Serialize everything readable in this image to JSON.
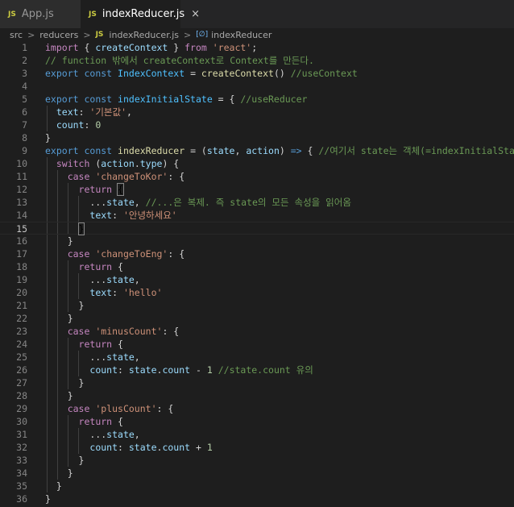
{
  "tabs": [
    {
      "icon": "JS",
      "label": "App.js",
      "active": false
    },
    {
      "icon": "JS",
      "label": "indexReducer.js",
      "active": true,
      "close": "×"
    }
  ],
  "breadcrumb": {
    "folders": [
      "src",
      "reducers"
    ],
    "file_icon": "JS",
    "file": "indexReducer.js",
    "symbol_icon": "[∅]",
    "symbol": "indexReducer",
    "separator": ">"
  },
  "editor": {
    "current_line": 15,
    "colors": {
      "background": "#1e1e1e",
      "keyword": "#569cd6",
      "control": "#c586c0",
      "function": "#dcdcaa",
      "variable": "#9cdcfe",
      "string": "#ce9178",
      "number": "#b5cea8",
      "comment": "#6a9955"
    },
    "lines": [
      [
        [
          "c",
          "import"
        ],
        [
          "p",
          " { "
        ],
        [
          "v",
          "createContext"
        ],
        [
          "p",
          " } "
        ],
        [
          "c",
          "from"
        ],
        [
          "p",
          " "
        ],
        [
          "s",
          "'react'"
        ],
        [
          "p",
          ";"
        ]
      ],
      [
        [
          "cm",
          "// function 밖에서 createContext로 Context를 만든다."
        ]
      ],
      [
        [
          "k",
          "export"
        ],
        [
          "p",
          " "
        ],
        [
          "k",
          "const"
        ],
        [
          "p",
          " "
        ],
        [
          "cv",
          "IndexContext"
        ],
        [
          "p",
          " = "
        ],
        [
          "f",
          "createContext"
        ],
        [
          "p",
          "() "
        ],
        [
          "cm",
          "//useContext"
        ]
      ],
      [],
      [
        [
          "k",
          "export"
        ],
        [
          "p",
          " "
        ],
        [
          "k",
          "const"
        ],
        [
          "p",
          " "
        ],
        [
          "cv",
          "indexInitialState"
        ],
        [
          "p",
          " = { "
        ],
        [
          "cm",
          "//useReducer"
        ]
      ],
      [
        [
          "p",
          "  "
        ],
        [
          "v",
          "text"
        ],
        [
          "p",
          ": "
        ],
        [
          "s",
          "'기본값'"
        ],
        [
          "p",
          ","
        ]
      ],
      [
        [
          "p",
          "  "
        ],
        [
          "v",
          "count"
        ],
        [
          "p",
          ": "
        ],
        [
          "n",
          "0"
        ]
      ],
      [
        [
          "p",
          "}"
        ]
      ],
      [
        [
          "k",
          "export"
        ],
        [
          "p",
          " "
        ],
        [
          "k",
          "const"
        ],
        [
          "p",
          " "
        ],
        [
          "f",
          "indexReducer"
        ],
        [
          "p",
          " = ("
        ],
        [
          "v",
          "state"
        ],
        [
          "p",
          ", "
        ],
        [
          "v",
          "action"
        ],
        [
          "p",
          ") "
        ],
        [
          "k",
          "=>"
        ],
        [
          "p",
          " { "
        ],
        [
          "cm",
          "//여기서 state는 객체(=indexInitialState)"
        ]
      ],
      [
        [
          "p",
          "  "
        ],
        [
          "c",
          "switch"
        ],
        [
          "p",
          " ("
        ],
        [
          "v",
          "action"
        ],
        [
          "p",
          "."
        ],
        [
          "v",
          "type"
        ],
        [
          "p",
          ") {"
        ]
      ],
      [
        [
          "p",
          "    "
        ],
        [
          "c",
          "case"
        ],
        [
          "p",
          " "
        ],
        [
          "s",
          "'changeToKor'"
        ],
        [
          "p",
          ": {"
        ]
      ],
      [
        [
          "p",
          "      "
        ],
        [
          "c",
          "return"
        ],
        [
          "p",
          " "
        ],
        [
          "bm",
          "{"
        ]
      ],
      [
        [
          "p",
          "        ..."
        ],
        [
          "v",
          "state"
        ],
        [
          "p",
          ", "
        ],
        [
          "cm",
          "//...은 복제. 즉 state의 모든 속성을 읽어옴"
        ]
      ],
      [
        [
          "p",
          "        "
        ],
        [
          "v",
          "text"
        ],
        [
          "p",
          ": "
        ],
        [
          "s",
          "'안녕하세요'"
        ]
      ],
      [
        [
          "p",
          "      "
        ],
        [
          "bm",
          "}"
        ]
      ],
      [
        [
          "p",
          "    }"
        ]
      ],
      [
        [
          "p",
          "    "
        ],
        [
          "c",
          "case"
        ],
        [
          "p",
          " "
        ],
        [
          "s",
          "'changeToEng'"
        ],
        [
          "p",
          ": {"
        ]
      ],
      [
        [
          "p",
          "      "
        ],
        [
          "c",
          "return"
        ],
        [
          "p",
          " {"
        ]
      ],
      [
        [
          "p",
          "        ..."
        ],
        [
          "v",
          "state"
        ],
        [
          "p",
          ","
        ]
      ],
      [
        [
          "p",
          "        "
        ],
        [
          "v",
          "text"
        ],
        [
          "p",
          ": "
        ],
        [
          "s",
          "'hello'"
        ]
      ],
      [
        [
          "p",
          "      }"
        ]
      ],
      [
        [
          "p",
          "    }"
        ]
      ],
      [
        [
          "p",
          "    "
        ],
        [
          "c",
          "case"
        ],
        [
          "p",
          " "
        ],
        [
          "s",
          "'minusCount'"
        ],
        [
          "p",
          ": {"
        ]
      ],
      [
        [
          "p",
          "      "
        ],
        [
          "c",
          "return"
        ],
        [
          "p",
          " {"
        ]
      ],
      [
        [
          "p",
          "        ..."
        ],
        [
          "v",
          "state"
        ],
        [
          "p",
          ","
        ]
      ],
      [
        [
          "p",
          "        "
        ],
        [
          "v",
          "count"
        ],
        [
          "p",
          ": "
        ],
        [
          "v",
          "state"
        ],
        [
          "p",
          "."
        ],
        [
          "v",
          "count"
        ],
        [
          "p",
          " - "
        ],
        [
          "n",
          "1"
        ],
        [
          "p",
          " "
        ],
        [
          "cm",
          "//state.count 유의"
        ]
      ],
      [
        [
          "p",
          "      }"
        ]
      ],
      [
        [
          "p",
          "    }"
        ]
      ],
      [
        [
          "p",
          "    "
        ],
        [
          "c",
          "case"
        ],
        [
          "p",
          " "
        ],
        [
          "s",
          "'plusCount'"
        ],
        [
          "p",
          ": {"
        ]
      ],
      [
        [
          "p",
          "      "
        ],
        [
          "c",
          "return"
        ],
        [
          "p",
          " {"
        ]
      ],
      [
        [
          "p",
          "        ..."
        ],
        [
          "v",
          "state"
        ],
        [
          "p",
          ","
        ]
      ],
      [
        [
          "p",
          "        "
        ],
        [
          "v",
          "count"
        ],
        [
          "p",
          ": "
        ],
        [
          "v",
          "state"
        ],
        [
          "p",
          "."
        ],
        [
          "v",
          "count"
        ],
        [
          "p",
          " + "
        ],
        [
          "n",
          "1"
        ]
      ],
      [
        [
          "p",
          "      }"
        ]
      ],
      [
        [
          "p",
          "    }"
        ]
      ],
      [
        [
          "p",
          "  }"
        ]
      ],
      [
        [
          "p",
          "}"
        ]
      ]
    ]
  }
}
